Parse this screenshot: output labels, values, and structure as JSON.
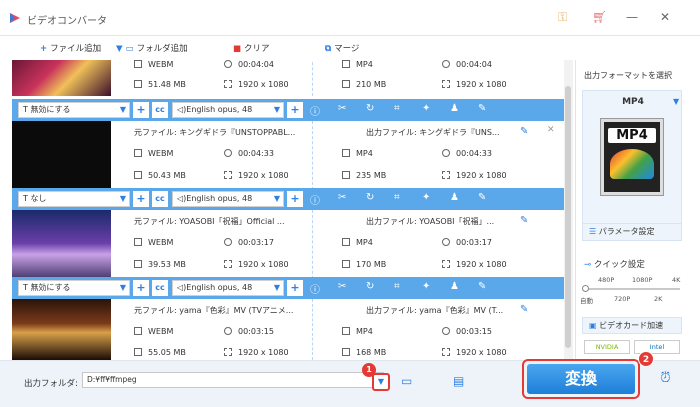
{
  "app": {
    "title": "ビデオコンバータ"
  },
  "toolbar": {
    "add_file": "ファイル追加",
    "add_folder": "フォルダ追加",
    "clear": "クリア",
    "merge": "マージ"
  },
  "items": [
    {
      "src_format": "WEBM",
      "src_duration": "00:04:04",
      "src_size": "51.48 MB",
      "src_res": "1920 x 1080",
      "out_format": "MP4",
      "out_duration": "00:04:04",
      "out_size": "210 MB",
      "out_res": "1920 x 1080"
    },
    {
      "src_name": "元ファイル: キングギドラ『UNSTOPPABL...",
      "out_name": "出力ファイル: キングギドラ『UNS...",
      "src_format": "WEBM",
      "src_duration": "00:04:33",
      "src_size": "50.43 MB",
      "src_res": "1920 x 1080",
      "out_format": "MP4",
      "out_duration": "00:04:33",
      "out_size": "235 MB",
      "out_res": "1920 x 1080"
    },
    {
      "src_name": "元ファイル: YOASOBI「祝福」Official ...",
      "out_name": "出力ファイル: YOASOBI「祝福」...",
      "src_format": "WEBM",
      "src_duration": "00:03:17",
      "src_size": "39.53 MB",
      "src_res": "1920 x 1080",
      "out_format": "MP4",
      "out_duration": "00:03:17",
      "out_size": "170 MB",
      "out_res": "1920 x 1080"
    },
    {
      "src_name": "元ファイル: yama『色彩』MV (TVアニメ...",
      "out_name": "出力ファイル: yama『色彩』MV (T...",
      "src_format": "WEBM",
      "src_duration": "00:03:15",
      "src_size": "55.05 MB",
      "src_res": "1920 x 1080",
      "out_format": "MP4",
      "out_duration": "00:03:15",
      "out_size": "168 MB",
      "out_res": "1920 x 1080"
    }
  ],
  "bars": [
    {
      "subtitle": "無効にする",
      "audio": "English opus, 48"
    },
    {
      "subtitle": "なし",
      "audio": "English opus, 48"
    },
    {
      "subtitle": "無効にする",
      "audio": "English opus, 48"
    }
  ],
  "right_panel": {
    "title": "出力フォーマットを選択",
    "format": "MP4",
    "format_icon_text": "MP4",
    "params": "パラメータ設定",
    "quick": "クイック設定",
    "quality_top": [
      "480P",
      "1080P",
      "4K"
    ],
    "quality_bottom": [
      "自動",
      "720P",
      "2K"
    ],
    "accel": "ビデオカード加速",
    "nvidia": "NVIDIA",
    "intel": "Intel"
  },
  "bottom": {
    "folder_label": "出力フォルダ:",
    "folder_value": "D:¥ff¥ffmpeg",
    "convert": "変換",
    "marker1": "1",
    "marker2": "2"
  },
  "colors": {
    "accent": "#2f7fe3",
    "bar": "#5aa7ea",
    "convert": "#2b8fe6",
    "marker": "#e53935"
  }
}
